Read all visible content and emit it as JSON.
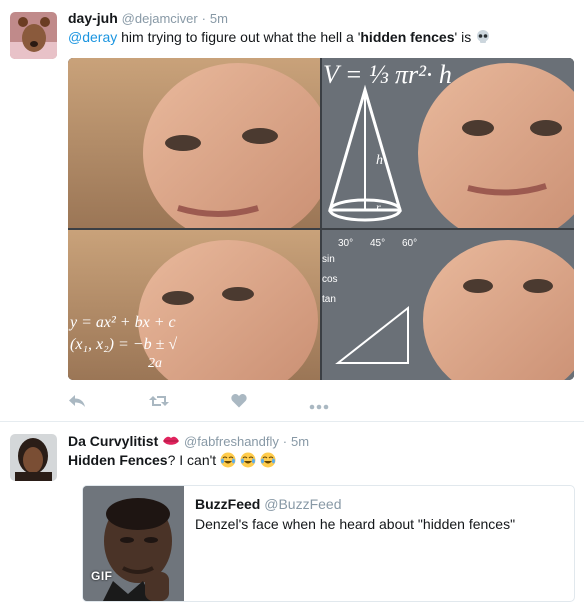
{
  "tweet1": {
    "name": "day-juh",
    "handle": "@dejamciver",
    "separator": "·",
    "time": "5m",
    "text": {
      "mention": "@deray",
      "part1": " him trying to figure out what the hell a '",
      "bold": "hidden fences",
      "part2": "' is"
    },
    "emoji": "skull-emoji",
    "media": {
      "formula_top": "V = ⅓ πr²· h",
      "formula_quad1": "y = ax² + bx + c",
      "formula_quad2": "(x₁, x₂) = −b ± √",
      "formula_quad3": "2a",
      "trig_sin": "sin",
      "trig_cos": "cos",
      "trig_tan": "tan",
      "angle30": "30°",
      "angle45": "45°",
      "angle60": "60°",
      "cone_h": "h",
      "cone_r": "r"
    },
    "actions": [
      "reply-icon",
      "retweet-icon",
      "like-icon",
      "more-icon"
    ]
  },
  "tweet2": {
    "name": "Da Curvylitist",
    "name_emoji": "lips-emoji",
    "handle": "@fabfreshandfly",
    "separator": "·",
    "time": "5m",
    "text": {
      "bold": "Hidden Fences",
      "part": "? I can't"
    },
    "emojis": [
      "joy-emoji",
      "joy-emoji",
      "joy-emoji"
    ],
    "quote": {
      "name": "BuzzFeed",
      "handle": "@BuzzFeed",
      "text": "Denzel's face when he heard about \"hidden fences\"",
      "badge": "GIF"
    }
  },
  "colors": {
    "link": "#1b95e0",
    "muted": "#8899a6",
    "text": "#14171a",
    "border": "#e6ecf0"
  }
}
